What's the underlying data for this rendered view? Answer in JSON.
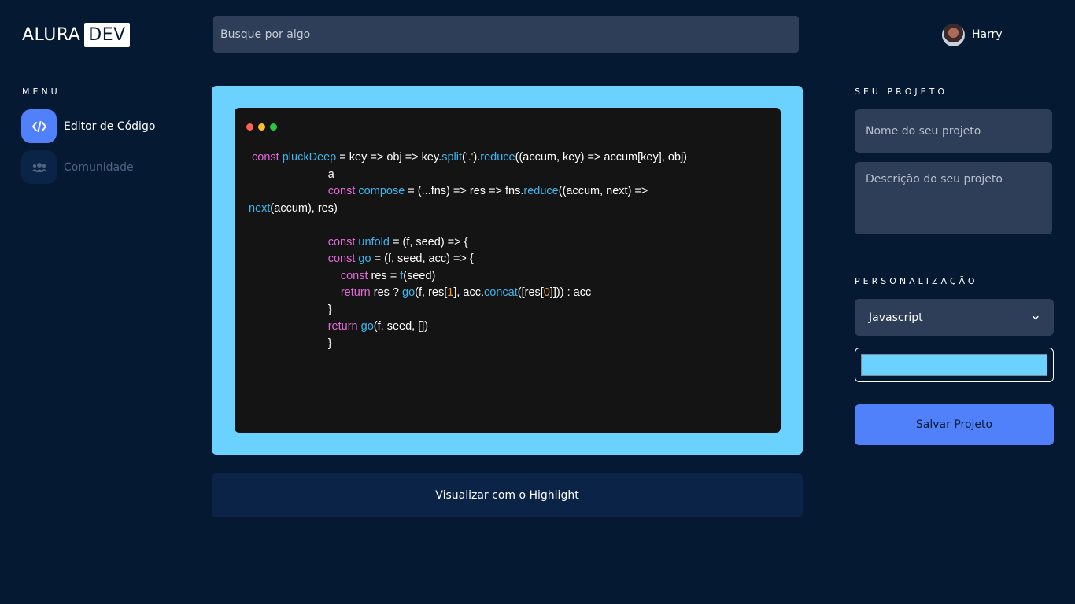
{
  "header": {
    "logo_text": "ALURA",
    "logo_box": "DEV",
    "search_placeholder": "Busque por algo",
    "user_name": "Harry"
  },
  "menu": {
    "title": "MENU",
    "items": [
      {
        "label": "Editor de Código",
        "icon": "code-icon",
        "active": true
      },
      {
        "label": "Comunidade",
        "icon": "users-icon",
        "active": false
      }
    ]
  },
  "editor": {
    "background_color": "#6bd1ff",
    "code_lines": [
      " const pluckDeep = key => obj => key.split('.').reduce((accum, key) => accum[key], obj)",
      "                         a",
      "                         const compose = (...fns) => res => fns.reduce((accum, next) =>",
      "next(accum), res)",
      "",
      "                         const unfold = (f, seed) => {",
      "                         const go = (f, seed, acc) => {",
      "                             const res = f(seed)",
      "                             return res ? go(f, res[1], acc.concat([res[0]])) : acc",
      "                         }",
      "                         return go(f, seed, [])",
      "                         }"
    ]
  },
  "highlight_button": "Visualizar com o Highlight",
  "project": {
    "title": "SEU PROJETO",
    "name_placeholder": "Nome do seu projeto",
    "description_placeholder": "Descrição do seu projeto"
  },
  "customization": {
    "title": "PERSONALIZAÇÃO",
    "language": "Javascript",
    "color": "#6bd1ff"
  },
  "save_button": "Salvar Projeto",
  "colors": {
    "background": "#051933",
    "accent": "#5081fb",
    "editor_frame": "#6bd1ff"
  }
}
